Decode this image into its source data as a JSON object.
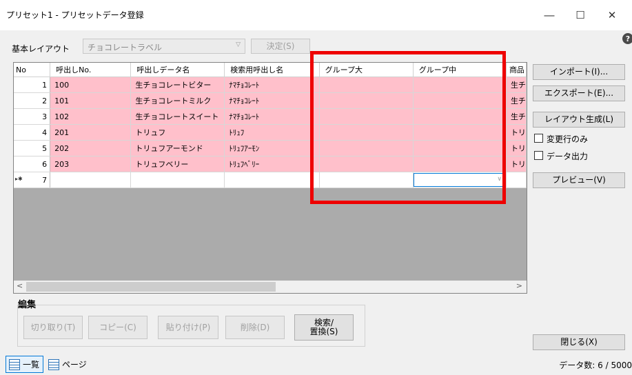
{
  "window": {
    "title": "プリセット1 - プリセットデータ登録",
    "help": "?"
  },
  "layout": {
    "label": "基本レイアウト",
    "selected": "チョコレートラベル",
    "decide_button": "決定(S)"
  },
  "grid": {
    "columns": [
      "No",
      "呼出しNo.",
      "呼出しデータ名",
      "検索用呼出し名",
      "グループ大",
      "グループ中",
      "商品"
    ],
    "rows": [
      {
        "no": "1",
        "call_no": "100",
        "name": "生チョコレートビター",
        "search": "ﾅﾏﾁｮｺﾚｰﾄ",
        "group_l": "",
        "group_m": "",
        "product": "生チ"
      },
      {
        "no": "2",
        "call_no": "101",
        "name": "生チョコレートミルク",
        "search": "ﾅﾏﾁｮｺﾚｰﾄ",
        "group_l": "",
        "group_m": "",
        "product": "生チ"
      },
      {
        "no": "3",
        "call_no": "102",
        "name": "生チョコレートスイート",
        "search": "ﾅﾏﾁｮｺﾚｰﾄ",
        "group_l": "",
        "group_m": "",
        "product": "生チ"
      },
      {
        "no": "4",
        "call_no": "201",
        "name": "トリュフ",
        "search": "ﾄﾘｭﾌ",
        "group_l": "",
        "group_m": "",
        "product": "トリ"
      },
      {
        "no": "5",
        "call_no": "202",
        "name": "トリュフアーモンド",
        "search": "ﾄﾘｭﾌｱｰﾓﾝ",
        "group_l": "",
        "group_m": "",
        "product": "トリ"
      },
      {
        "no": "6",
        "call_no": "203",
        "name": "トリュフベリー",
        "search": "ﾄﾘｭﾌﾍﾞﾘｰ",
        "group_l": "",
        "group_m": "",
        "product": "トリ"
      }
    ],
    "new_row": {
      "marker": "▸✱",
      "no": "7"
    },
    "highlight_color": "#ffc0cb",
    "annotation_color": "#ee0000"
  },
  "edit": {
    "label": "編集",
    "cut": "切り取り(T)",
    "copy": "コピー(C)",
    "paste": "貼り付け(P)",
    "delete": "削除(D)",
    "search_line1": "検索/",
    "search_line2": "置換(S)"
  },
  "side": {
    "import": "インポート(I)...",
    "export": "エクスポート(E)...",
    "generate": "レイアウト生成(L)",
    "changed_only": "変更行のみ",
    "data_output": "データ出力",
    "preview": "プレビュー(V)",
    "close": "閉じる(X)"
  },
  "status": {
    "tab_list": "一覧",
    "tab_page": "ページ",
    "count": "データ数: 6 / 5000"
  }
}
